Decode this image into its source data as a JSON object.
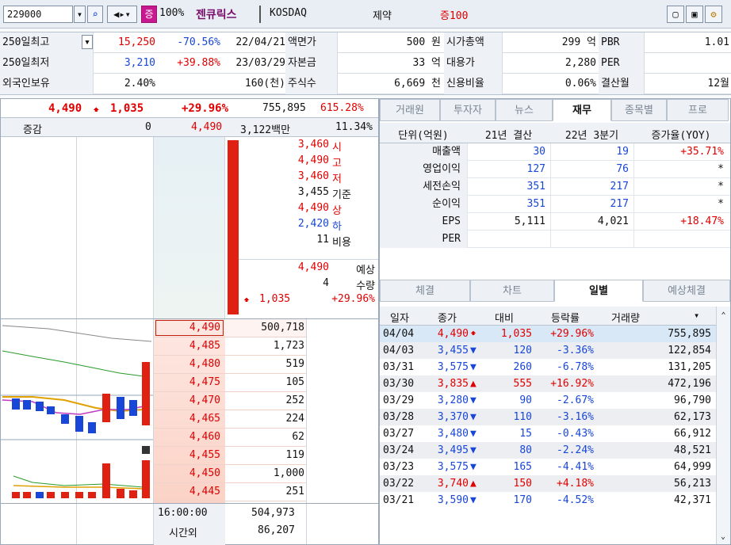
{
  "top": {
    "code": "229000",
    "badge": "증",
    "pct": "100%",
    "name": "젠큐릭스",
    "market": "KOSDAQ",
    "sector": "제약",
    "margin": "증100"
  },
  "info": {
    "r1": [
      "250일최고",
      "15,250",
      "-70.56%",
      "22/04/21",
      "액면가",
      "500 원",
      "시가총액",
      "299 억",
      "PBR",
      "1.01"
    ],
    "r2": [
      "250일최저",
      "3,210",
      "+39.88%",
      "23/03/29",
      "자본금",
      "33 억",
      "대용가",
      "2,280",
      "PER",
      ""
    ],
    "r3": [
      "외국인보유",
      "2.40%",
      "",
      "160(천)",
      "주식수",
      "6,669 천",
      "신용비율",
      "0.06%",
      "결산월",
      "12월"
    ]
  },
  "summary": {
    "price": "4,490",
    "change": "1,035",
    "rate": "+29.96%",
    "volume": "755,895",
    "ratio": "615.28%"
  },
  "quoteHeader": {
    "label": "증감",
    "val0": "0",
    "price": "4,490",
    "amount": "3,122백만",
    "pct": "11.34%"
  },
  "ohlc": [
    [
      "3,460",
      "시"
    ],
    [
      "4,490",
      "고"
    ],
    [
      "3,460",
      "저"
    ],
    [
      "3,455",
      "기준"
    ],
    [
      "4,490",
      "상"
    ],
    [
      "2,420",
      "하"
    ],
    [
      "11",
      "비용"
    ]
  ],
  "expected": {
    "price": "4,490",
    "plabel": "예상",
    "qty": "4",
    "qlabel": "수량",
    "chg": "1,035",
    "rate": "+29.96%"
  },
  "orderbook": [
    [
      "4,490",
      "500,718"
    ],
    [
      "4,485",
      "1,723"
    ],
    [
      "4,480",
      "519"
    ],
    [
      "4,475",
      "105"
    ],
    [
      "4,470",
      "252"
    ],
    [
      "4,465",
      "224"
    ],
    [
      "4,460",
      "62"
    ],
    [
      "4,455",
      "119"
    ],
    [
      "4,450",
      "1,000"
    ],
    [
      "4,445",
      "251"
    ]
  ],
  "footer": {
    "time": "16:00:00",
    "timeVol": "504,973",
    "after": "시간외",
    "afterVol": "86,207"
  },
  "tabs1": [
    "거래원",
    "투자자",
    "뉴스",
    "재무",
    "종목별",
    "프로"
  ],
  "finance": {
    "headers": [
      "단위(억원)",
      "21년 결산",
      "22년 3분기",
      "증가율(YOY)"
    ],
    "rows": [
      [
        "매출액",
        "30",
        "19",
        "+35.71%"
      ],
      [
        "영업이익",
        "127",
        "76",
        "*"
      ],
      [
        "세전손익",
        "351",
        "217",
        "*"
      ],
      [
        "순이익",
        "351",
        "217",
        "*"
      ],
      [
        "EPS",
        "5,111",
        "4,021",
        "+18.47%"
      ],
      [
        "PER",
        "",
        "",
        ""
      ]
    ]
  },
  "tabs2": [
    "체결",
    "차트",
    "일별",
    "예상체결"
  ],
  "daily": {
    "headers": [
      "일자",
      "종가",
      "대비",
      "등락률",
      "거래량"
    ],
    "rows": [
      [
        "04/04",
        "4,490",
        "up",
        "1,035",
        "+29.96%",
        "755,895"
      ],
      [
        "04/03",
        "3,455",
        "down",
        "120",
        "-3.36%",
        "122,854"
      ],
      [
        "03/31",
        "3,575",
        "down",
        "260",
        "-6.78%",
        "131,205"
      ],
      [
        "03/30",
        "3,835",
        "upsmall",
        "555",
        "+16.92%",
        "472,196"
      ],
      [
        "03/29",
        "3,280",
        "down",
        "90",
        "-2.67%",
        "96,790"
      ],
      [
        "03/28",
        "3,370",
        "down",
        "110",
        "-3.16%",
        "62,173"
      ],
      [
        "03/27",
        "3,480",
        "down",
        "15",
        "-0.43%",
        "66,912"
      ],
      [
        "03/24",
        "3,495",
        "down",
        "80",
        "-2.24%",
        "48,521"
      ],
      [
        "03/23",
        "3,575",
        "down",
        "165",
        "-4.41%",
        "64,999"
      ],
      [
        "03/22",
        "3,740",
        "upsmall",
        "150",
        "+4.18%",
        "56,213"
      ],
      [
        "03/21",
        "3,590",
        "down",
        "170",
        "-4.52%",
        "42,371"
      ]
    ]
  }
}
